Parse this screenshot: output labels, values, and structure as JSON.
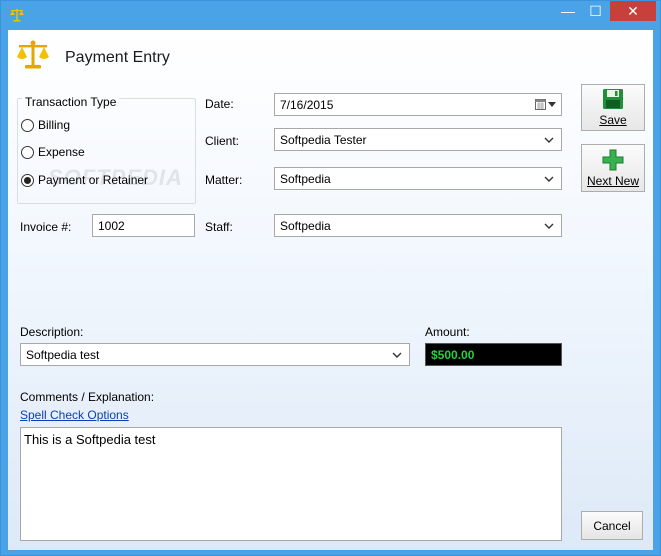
{
  "window": {
    "minimize": "—",
    "maximize": "☐",
    "close": "✕"
  },
  "header": {
    "title": "Payment Entry",
    "icon": "scale-icon"
  },
  "transaction_type": {
    "title": "Transaction Type",
    "options": [
      {
        "label": "Billing",
        "checked": false
      },
      {
        "label": "Expense",
        "checked": false
      },
      {
        "label": "Payment or Retainer",
        "checked": true
      }
    ]
  },
  "invoice": {
    "label": "Invoice #:",
    "value": "1002"
  },
  "date": {
    "label": "Date:",
    "value": "7/16/2015"
  },
  "client": {
    "label": "Client:",
    "value": "Softpedia Tester"
  },
  "matter": {
    "label": "Matter:",
    "value": "Softpedia"
  },
  "staff": {
    "label": "Staff:",
    "value": "Softpedia"
  },
  "description": {
    "label": "Description:",
    "value": "Softpedia test"
  },
  "amount": {
    "label": "Amount:",
    "value": "$500.00",
    "color": "#21d13a",
    "background": "#000000"
  },
  "comments": {
    "label": "Comments / Explanation:",
    "spell_check_link": "Spell Check Options",
    "value": "This is a Softpedia test"
  },
  "buttons": {
    "save": "Save",
    "next_new": "Next New",
    "cancel": "Cancel"
  },
  "watermark": "SOFTPEDIA",
  "colors": {
    "titlebar": "#4aa3e6",
    "close_button": "#c7403a",
    "link": "#0b3fb5"
  }
}
